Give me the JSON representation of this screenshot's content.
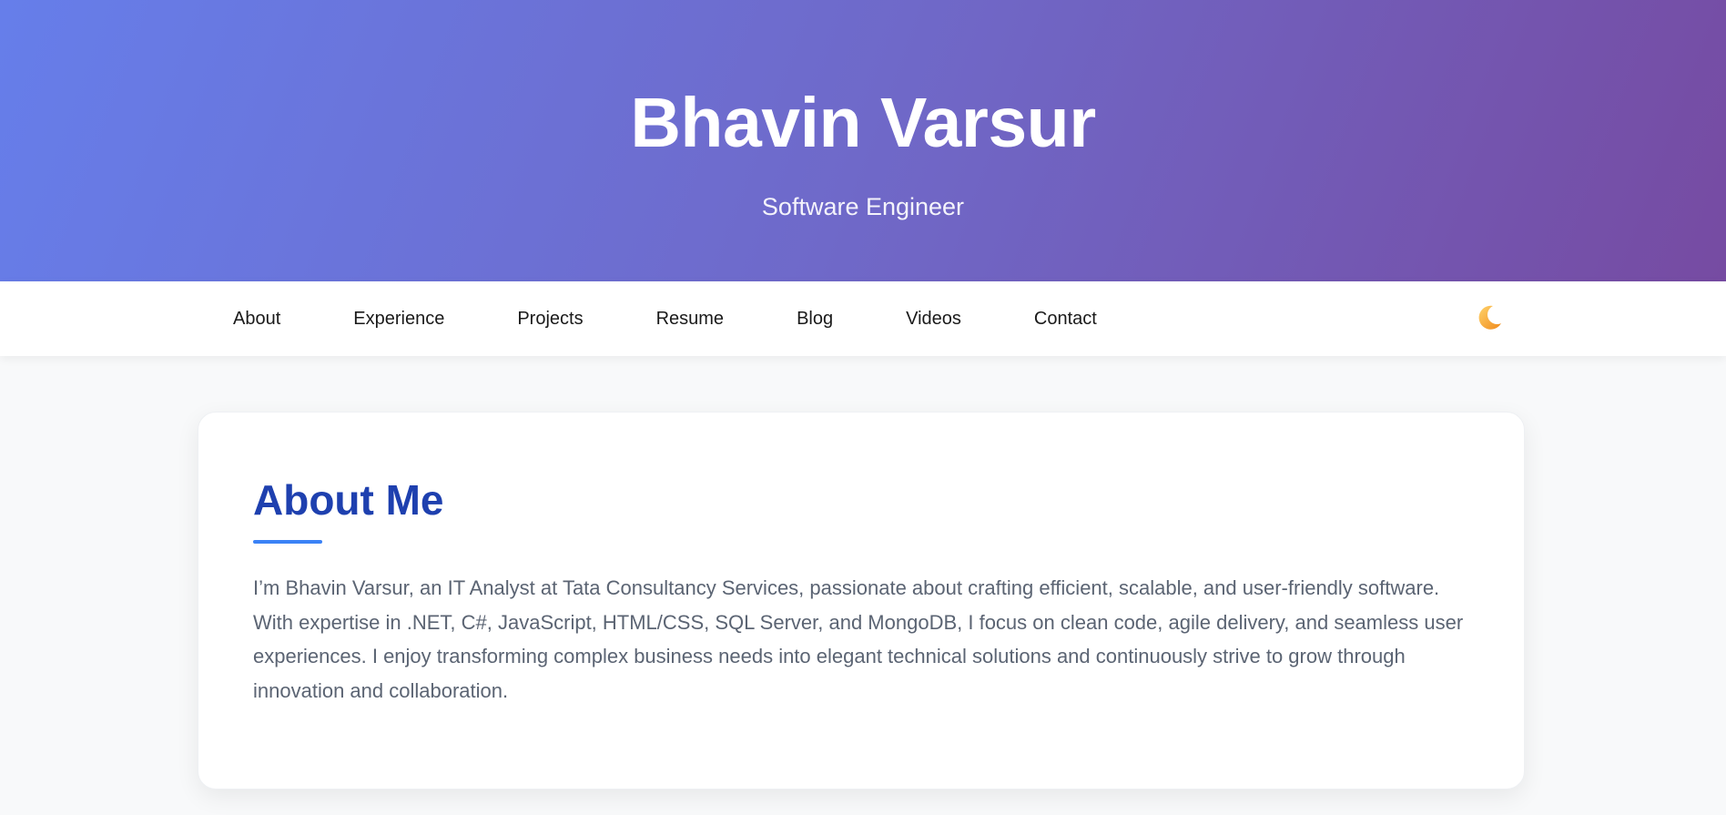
{
  "hero": {
    "name": "Bhavin Varsur",
    "subtitle": "Software Engineer"
  },
  "nav": {
    "items": [
      {
        "label": "About"
      },
      {
        "label": "Experience"
      },
      {
        "label": "Projects"
      },
      {
        "label": "Resume"
      },
      {
        "label": "Blog"
      },
      {
        "label": "Videos"
      },
      {
        "label": "Contact"
      }
    ],
    "theme_toggle_icon": "moon-icon"
  },
  "about": {
    "title": "About Me",
    "text": "I’m Bhavin Varsur, an IT Analyst at Tata Consultancy Services, passionate about crafting efficient, scalable, and user-friendly software. With expertise in .NET, C#, JavaScript, HTML/CSS, SQL Server, and MongoDB, I focus on clean code, agile delivery, and seamless user experiences. I enjoy transforming complex business needs into elegant technical solutions and continuously strive to grow through innovation and collaboration."
  },
  "colors": {
    "hero_gradient_start": "#667eea",
    "hero_gradient_end": "#764ba2",
    "section_title": "#1e40af",
    "accent": "#3b82f6",
    "moon": "#f5a623"
  }
}
